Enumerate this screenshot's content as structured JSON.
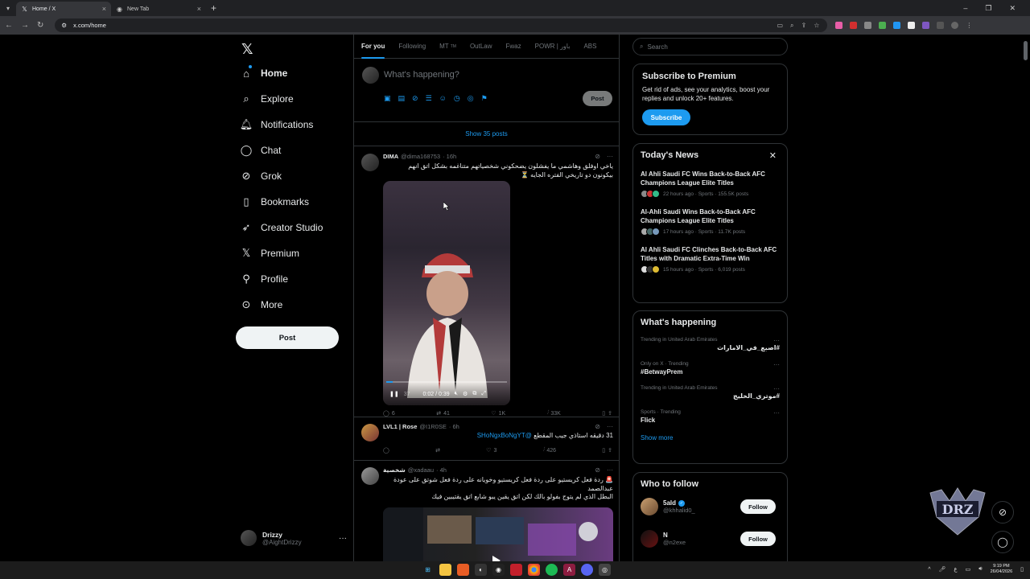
{
  "browser": {
    "tabs": [
      {
        "title": "Home / X",
        "active": true
      },
      {
        "title": "New Tab",
        "active": false
      }
    ],
    "url": "x.com/home"
  },
  "nav": {
    "items": [
      {
        "label": "Home",
        "icon": "home-icon"
      },
      {
        "label": "Explore",
        "icon": "search-icon"
      },
      {
        "label": "Notifications",
        "icon": "bell-icon"
      },
      {
        "label": "Chat",
        "icon": "chat-icon"
      },
      {
        "label": "Grok",
        "icon": "grok-icon"
      },
      {
        "label": "Bookmarks",
        "icon": "bookmark-icon"
      },
      {
        "label": "Creator Studio",
        "icon": "rocket-icon"
      },
      {
        "label": "Premium",
        "icon": "x-icon"
      },
      {
        "label": "Profile",
        "icon": "person-icon"
      },
      {
        "label": "More",
        "icon": "more-circle-icon"
      }
    ],
    "post_label": "Post",
    "user": {
      "name": "Drizzy",
      "handle": "@AightDrizzy"
    }
  },
  "feed": {
    "tabs": [
      "For you",
      "Following",
      "MT",
      "OutLaw",
      "Fwaz",
      "POWR | باور",
      "ABS"
    ],
    "tm_mark": "TM",
    "composer_placeholder": "What's happening?",
    "composer_post": "Post",
    "show_posts": "Show 35 posts",
    "tweets": [
      {
        "name": "DIMA",
        "handle": "@dima168753",
        "time": "· 16h",
        "text_line1": "ياخي اوفلق وهاشمي ما يفشلون يضحكوني شخصياتهم متناغمه بشكل اتق انهم",
        "text_line2": "بيكونون دو تاريخي الفتره الجايه ⏳",
        "video_time": "0:02 / 0:39",
        "video_badge": "37",
        "replies": "6",
        "reposts": "41",
        "likes": "1K",
        "views": "33K"
      },
      {
        "name": "LVL1 | Rose",
        "handle": "@I1R0SE",
        "time": "· 6h",
        "text": "31 دقيقه استاذي جيب المقطع",
        "mention": "@SHoNgxBoNgYT",
        "replies": "",
        "reposts": "",
        "likes": "3",
        "views": "426"
      },
      {
        "name": "شخصية",
        "handle": "@xadaau",
        "time": "· 4h",
        "text_line1": "🚨 ردة فعل كريستيو على ردة فعل كريستيو وخويانه على ردة فعل شوتق على عودة",
        "text_line2": "عبدالصمد",
        "text_line3": "البطل الذي لم يتوج بفولو بالك لكن اتق يقين يبو شابع اتق يقتيبين فيك"
      }
    ]
  },
  "right": {
    "search_placeholder": "Search",
    "premium": {
      "title": "Subscribe to Premium",
      "body": "Get rid of ads, see your analytics, boost your replies and unlock 20+ features.",
      "button": "Subscribe"
    },
    "news": {
      "title": "Today's News",
      "items": [
        {
          "headline": "Al Ahli Saudi FC Wins Back-to-Back AFC Champions League Elite Titles",
          "meta": "22 hours ago · Sports · 155.5K posts"
        },
        {
          "headline": "Al-Ahli Saudi Wins Back-to-Back AFC Champions League Elite Titles",
          "meta": "17 hours ago · Sports · 11.7K posts"
        },
        {
          "headline": "Al Ahli Saudi FC Clinches Back-to-Back AFC Titles with Dramatic Extra-Time Win",
          "meta": "15 hours ago · Sports · 6,019 posts"
        }
      ]
    },
    "happening": {
      "title": "What's happening",
      "trends": [
        {
          "meta": "Trending in United Arab Emirates",
          "name": "#اصبع_في_الامارات",
          "rtl": true
        },
        {
          "meta": "Only on X · Trending",
          "name": "#BetwayPrem",
          "rtl": false
        },
        {
          "meta": "Trending in United Arab Emirates",
          "name": "#موتري_الخليج",
          "rtl": true
        },
        {
          "meta": "Sports · Trending",
          "name": "Flick",
          "rtl": false
        }
      ],
      "show_more": "Show more"
    },
    "follow": {
      "title": "Who to follow",
      "people": [
        {
          "name": "5ald",
          "handle": "@khhalid0_",
          "verified": true,
          "button": "Follow"
        },
        {
          "name": "N",
          "handle": "@n2exe",
          "verified": false,
          "button": "Follow"
        }
      ]
    }
  },
  "taskbar": {
    "time": "9:19 PM",
    "date": "26/04/2026",
    "lang": "ع"
  }
}
